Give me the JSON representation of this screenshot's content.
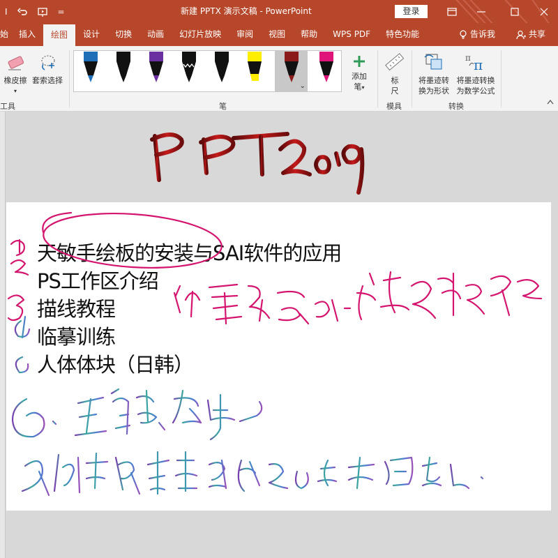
{
  "titlebar": {
    "title": "新建 PPTX 演示文稿 - PowerPoint",
    "login": "登录",
    "left_partial": "I",
    "dropdown": "="
  },
  "tabs": [
    {
      "label": "始"
    },
    {
      "label": "插入"
    },
    {
      "label": "绘图"
    },
    {
      "label": "设计"
    },
    {
      "label": "切换"
    },
    {
      "label": "动画"
    },
    {
      "label": "幻灯片放映"
    },
    {
      "label": "审阅"
    },
    {
      "label": "视图"
    },
    {
      "label": "帮助"
    },
    {
      "label": "WPS PDF"
    },
    {
      "label": "特色功能"
    }
  ],
  "tab_extras": {
    "tell_me": "告诉我",
    "share": "共享"
  },
  "ribbon": {
    "eraser": "橡皮擦",
    "lasso": "套索选择",
    "tools_group": "工具",
    "pens_group": "笔",
    "add_pen": [
      "添加",
      "笔"
    ],
    "ruler": [
      "标",
      "尺"
    ],
    "stencils_group": "模具",
    "ink_to_shape": [
      "将墨迹转",
      "换为形状"
    ],
    "ink_to_math": [
      "将墨迹转换",
      "为数学公式"
    ],
    "convert_group": "转换",
    "pens": [
      {
        "color": "#1f6fb8"
      },
      {
        "color": "#111111"
      },
      {
        "color": "#6a2fa0"
      },
      {
        "color": "#111111"
      },
      {
        "color": "#111111"
      },
      {
        "color": "#ffee00"
      },
      {
        "color": "#8b1a1a"
      },
      {
        "color": "#e0157a"
      }
    ]
  },
  "slide": {
    "bullets": [
      "天敏手绘板的安装与SAI软件的应用",
      "PS工作区介绍",
      "描线教程",
      "临摹训练",
      "人体体块（日韩）"
    ]
  },
  "colors": {
    "accent": "#b7472a",
    "ribbon_bg": "#f3f3f3",
    "workspace": "#d8d8d8"
  }
}
